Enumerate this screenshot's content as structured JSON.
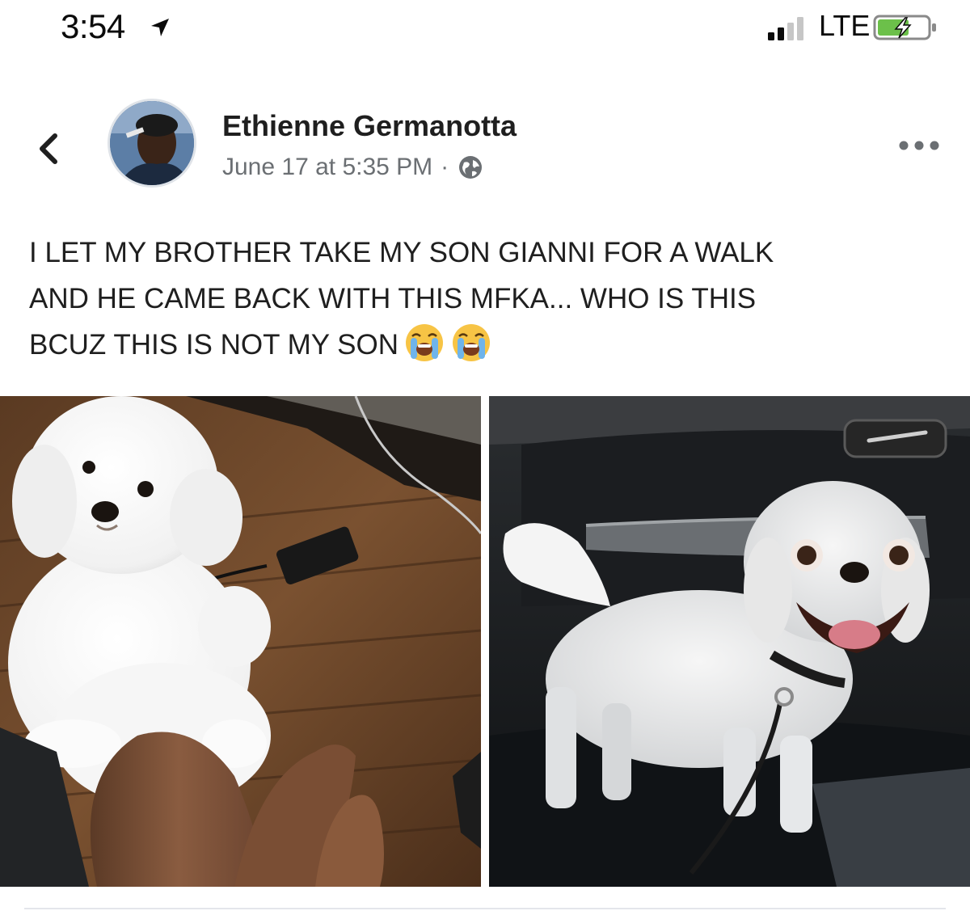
{
  "status_bar": {
    "time": "3:54",
    "network": "LTE",
    "location_icon": "location-arrow-icon",
    "signal_icon": "signal-bars-icon",
    "battery_icon": "battery-charging-icon"
  },
  "post": {
    "author": "Ethienne Germanotta",
    "timestamp": "June 17 at 5:35 PM",
    "separator": "·",
    "privacy_icon": "globe-icon",
    "caption_lines": [
      "I LET MY BROTHER TAKE MY SON GIANNI FOR A WALK",
      "AND HE CAME BACK WITH THIS MFKA... WHO IS THIS",
      "BCUZ THIS IS NOT MY SON"
    ],
    "caption_emoji": "loudly-crying-face-icon",
    "photos": [
      {
        "name": "fluffy-white-dog-photo"
      },
      {
        "name": "shaved-dog-in-car-photo"
      }
    ]
  },
  "colors": {
    "text": "#1f1f1f",
    "meta": "#6b6f73",
    "battery_green": "#6cc04a"
  }
}
